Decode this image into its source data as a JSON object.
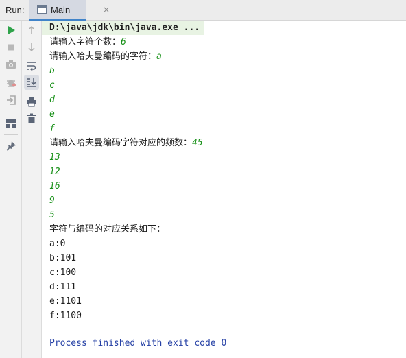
{
  "header": {
    "run_label": "Run:",
    "tab_label": "Main",
    "close_glyph": "×"
  },
  "toolbar": {
    "left": [
      "run-icon",
      "stop-icon",
      "camera-icon",
      "debug-icon",
      "login-icon",
      "layout-icon",
      "pin-icon"
    ],
    "right": [
      "up-arrow-icon",
      "down-arrow-icon",
      "soft-wrap-icon",
      "scroll-to-end-icon",
      "print-icon",
      "trash-icon"
    ]
  },
  "console": {
    "command": "D:\\java\\jdk\\bin\\java.exe ...",
    "prompt_count": "请输入字符个数：",
    "input_count": "6",
    "prompt_chars": "请输入哈夫曼编码的字符：",
    "input_chars": [
      "a",
      "b",
      "c",
      "d",
      "e",
      "f"
    ],
    "prompt_freq": "请输入哈夫曼编码字符对应的频数：",
    "input_freqs": [
      "45",
      "13",
      "12",
      "16",
      "9",
      "5"
    ],
    "result_heading": "字符与编码的对应关系如下：",
    "results": [
      "a:0",
      "b:101",
      "c:100",
      "d:111",
      "e:1101",
      "f:1100"
    ],
    "finish": "Process finished with exit code 0"
  },
  "colors": {
    "run_green": "#2fa34a",
    "input_green": "#199119",
    "process_blue": "#2540a5",
    "tab_accent": "#4083c9"
  }
}
